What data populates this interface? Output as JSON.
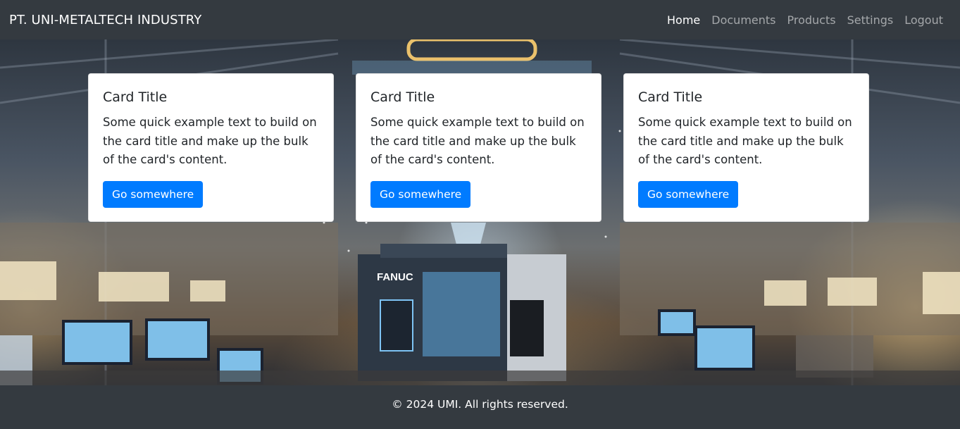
{
  "navbar": {
    "brand": "PT. UNI-METALTECH INDUSTRY",
    "links": [
      {
        "label": "Home",
        "active": true
      },
      {
        "label": "Documents",
        "active": false
      },
      {
        "label": "Products",
        "active": false
      },
      {
        "label": "Settings",
        "active": false
      },
      {
        "label": "Logout",
        "active": false
      }
    ]
  },
  "hero": {
    "machine_label": "FANUC"
  },
  "cards": [
    {
      "title": "Card Title",
      "text": "Some quick example text to build on the card title and make up the bulk of the card's content.",
      "button": "Go somewhere"
    },
    {
      "title": "Card Title",
      "text": "Some quick example text to build on the card title and make up the bulk of the card's content.",
      "button": "Go somewhere"
    },
    {
      "title": "Card Title",
      "text": "Some quick example text to build on the card title and make up the bulk of the card's content.",
      "button": "Go somewhere"
    }
  ],
  "footer": {
    "text": "© 2024 UMI. All rights reserved."
  },
  "colors": {
    "navbar_bg": "#343a40",
    "primary": "#007bff",
    "card_bg": "#ffffff"
  }
}
